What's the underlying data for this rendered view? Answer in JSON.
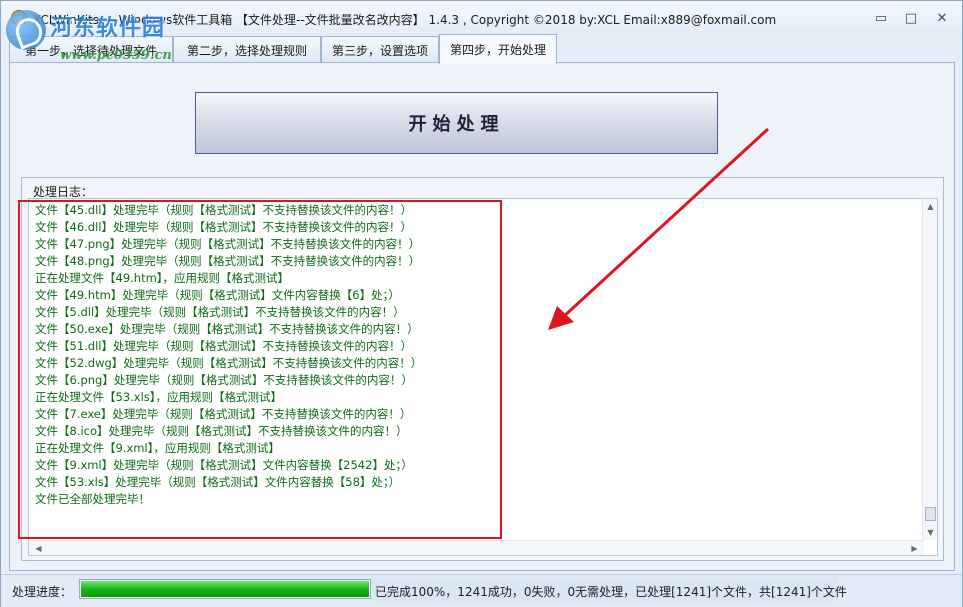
{
  "window": {
    "title": "XCLWinKits — Windows软件工具箱 【文件处理--文件批量改名改内容】 1.4.3 , Copyright ©2018 by:XCL Email:x889@foxmail.com",
    "minimize_label": "▭",
    "maximize_label": "□",
    "close_label": "✕"
  },
  "watermark": {
    "title": "河东软件园",
    "url": "www.pc0359.cn"
  },
  "tabs": [
    {
      "label": "第一步，选择待处理文件"
    },
    {
      "label": "第二步，选择处理规则"
    },
    {
      "label": "第三步，设置选项"
    },
    {
      "label": "第四步，开始处理"
    }
  ],
  "main": {
    "start_button_label": "开始处理",
    "log_label": "处理日志："
  },
  "log_lines": [
    "文件【45.dll】处理完毕（规则【格式测试】不支持替换该文件的内容！）",
    "文件【46.dll】处理完毕（规则【格式测试】不支持替换该文件的内容！）",
    "文件【47.png】处理完毕（规则【格式测试】不支持替换该文件的内容！）",
    "文件【48.png】处理完毕（规则【格式测试】不支持替换该文件的内容！）",
    "正在处理文件【49.htm】，应用规则【格式测试】",
    "文件【49.htm】处理完毕（规则【格式测试】文件内容替换【6】处；）",
    "文件【5.dll】处理完毕（规则【格式测试】不支持替换该文件的内容！）",
    "文件【50.exe】处理完毕（规则【格式测试】不支持替换该文件的内容！）",
    "文件【51.dll】处理完毕（规则【格式测试】不支持替换该文件的内容！）",
    "文件【52.dwg】处理完毕（规则【格式测试】不支持替换该文件的内容！）",
    "文件【6.png】处理完毕（规则【格式测试】不支持替换该文件的内容！）",
    "正在处理文件【53.xls】，应用规则【格式测试】",
    "文件【7.exe】处理完毕（规则【格式测试】不支持替换该文件的内容！）",
    "文件【8.ico】处理完毕（规则【格式测试】不支持替换该文件的内容！）",
    "正在处理文件【9.xml】，应用规则【格式测试】",
    "文件【9.xml】处理完毕（规则【格式测试】文件内容替换【2542】处；）",
    "文件【53.xls】处理完毕（规则【格式测试】文件内容替换【58】处；）",
    "文件已全部处理完毕！"
  ],
  "status": {
    "label": "处理进度：",
    "progress_percent": 100,
    "text": "已完成100%，1241成功，0失败，0无需处理，已处理[1241]个文件，共[1241]个文件"
  },
  "colors": {
    "log_text": "#0d6b17",
    "highlight": "#e0141e",
    "progress": "#19b319"
  }
}
